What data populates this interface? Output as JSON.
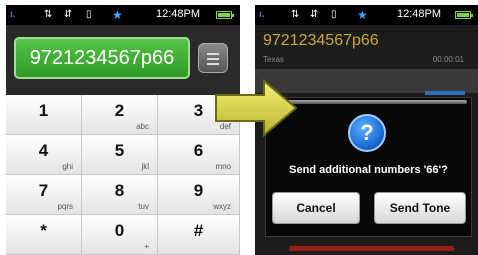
{
  "left_phone": {
    "status": {
      "time": "12:48PM"
    },
    "dialed_number": "9721234567p66",
    "keys": [
      {
        "digit": "1",
        "letters": ""
      },
      {
        "digit": "2",
        "letters": "abc"
      },
      {
        "digit": "3",
        "letters": "def"
      },
      {
        "digit": "4",
        "letters": "ghi"
      },
      {
        "digit": "5",
        "letters": "jkl"
      },
      {
        "digit": "6",
        "letters": "mno"
      },
      {
        "digit": "7",
        "letters": "pqrs"
      },
      {
        "digit": "8",
        "letters": "tuv"
      },
      {
        "digit": "9",
        "letters": "wxyz"
      },
      {
        "digit": "*",
        "letters": ""
      },
      {
        "digit": "0",
        "letters": "+"
      },
      {
        "digit": "#",
        "letters": ""
      }
    ]
  },
  "right_phone": {
    "status": {
      "time": "12:48PM"
    },
    "call_number": "9721234567p66",
    "call_location": "Texas",
    "call_timer": "00:00:01",
    "dialog": {
      "message": "Send additional numbers '66'?",
      "cancel_label": "Cancel",
      "confirm_label": "Send Tone"
    }
  },
  "colors": {
    "accent_green": "#3aa52c",
    "arrow_yellow": "#d6d24a",
    "call_number_gold": "#c8a93a",
    "dialog_blue": "#1d6fd8"
  },
  "icons": [
    "signal-icon",
    "data-icon",
    "wifi-icon",
    "vibrate-icon",
    "bluetooth-icon",
    "battery-icon",
    "backspace-icon",
    "question-icon",
    "arrow-right-icon"
  ]
}
